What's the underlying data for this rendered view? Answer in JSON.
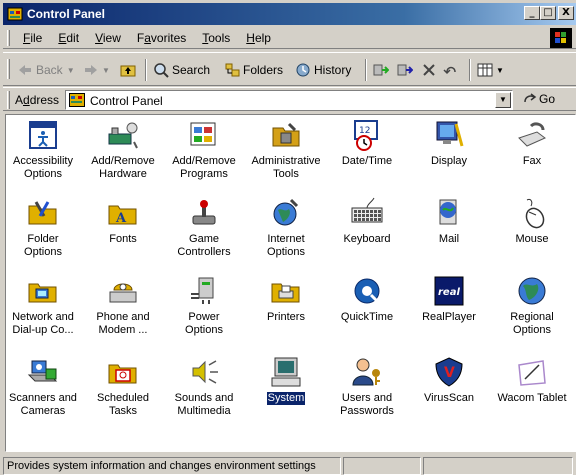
{
  "window": {
    "title": "Control Panel",
    "controls": {
      "minimize": "_",
      "maximize": "□",
      "close": "X"
    }
  },
  "menubar": {
    "items": [
      {
        "accel": "F",
        "rest": "ile"
      },
      {
        "accel": "E",
        "rest": "dit"
      },
      {
        "accel": "V",
        "rest": "iew"
      },
      {
        "pre": "F",
        "accel": "a",
        "rest": "vorites"
      },
      {
        "accel": "T",
        "rest": "ools"
      },
      {
        "accel": "H",
        "rest": "elp"
      }
    ]
  },
  "toolbar": {
    "back": "Back",
    "search": "Search",
    "folders": "Folders",
    "history": "History"
  },
  "addressbar": {
    "label_accel": "d",
    "label_pre": "A",
    "label_rest": "dress",
    "value": "Control Panel",
    "go": "Go"
  },
  "items": [
    {
      "label1": "Accessibility",
      "label2": "Options",
      "icon": "accessibility-icon",
      "color": "#1a5fb4"
    },
    {
      "label1": "Add/Remove",
      "label2": "Hardware",
      "icon": "add-remove-hardware-icon",
      "color": "#2e8b57"
    },
    {
      "label1": "Add/Remove",
      "label2": "Programs",
      "icon": "add-remove-programs-icon",
      "color": "#3a7bd5"
    },
    {
      "label1": "Administrative",
      "label2": "Tools",
      "icon": "administrative-tools-icon",
      "color": "#d4a017"
    },
    {
      "label1": "Date/Time",
      "label2": "",
      "icon": "date-time-icon",
      "color": "#1a3d8f"
    },
    {
      "label1": "Display",
      "label2": "",
      "icon": "display-icon",
      "color": "#3355aa"
    },
    {
      "label1": "Fax",
      "label2": "",
      "icon": "fax-icon",
      "color": "#999999"
    },
    {
      "label1": "Folder Options",
      "label2": "",
      "icon": "folder-options-icon",
      "color": "#e0b000"
    },
    {
      "label1": "Fonts",
      "label2": "",
      "icon": "fonts-icon",
      "color": "#e0b000"
    },
    {
      "label1": "Game",
      "label2": "Controllers",
      "icon": "game-controllers-icon",
      "color": "#888888"
    },
    {
      "label1": "Internet",
      "label2": "Options",
      "icon": "internet-options-icon",
      "color": "#2e8b57"
    },
    {
      "label1": "Keyboard",
      "label2": "",
      "icon": "keyboard-icon",
      "color": "#555555"
    },
    {
      "label1": "Mail",
      "label2": "",
      "icon": "mail-icon",
      "color": "#3366cc"
    },
    {
      "label1": "Mouse",
      "label2": "",
      "icon": "mouse-icon",
      "color": "#cccccc"
    },
    {
      "label1": "Network and",
      "label2": "Dial-up Co...",
      "icon": "network-icon",
      "color": "#3a7bd5"
    },
    {
      "label1": "Phone and",
      "label2": "Modem ...",
      "icon": "phone-modem-icon",
      "color": "#e0b000"
    },
    {
      "label1": "Power Options",
      "label2": "",
      "icon": "power-options-icon",
      "color": "#888888"
    },
    {
      "label1": "Printers",
      "label2": "",
      "icon": "printers-icon",
      "color": "#e0b000"
    },
    {
      "label1": "QuickTime",
      "label2": "",
      "icon": "quicktime-icon",
      "color": "#1a5fb4"
    },
    {
      "label1": "RealPlayer",
      "label2": "",
      "icon": "realplayer-icon",
      "color": "#0a1a6a"
    },
    {
      "label1": "Regional",
      "label2": "Options",
      "icon": "regional-options-icon",
      "color": "#2e8b57"
    },
    {
      "label1": "Scanners and",
      "label2": "Cameras",
      "icon": "scanners-icon",
      "color": "#3a7bd5"
    },
    {
      "label1": "Scheduled",
      "label2": "Tasks",
      "icon": "scheduled-tasks-icon",
      "color": "#e0b000"
    },
    {
      "label1": "Sounds and",
      "label2": "Multimedia",
      "icon": "sounds-icon",
      "color": "#d4c000"
    },
    {
      "label1": "System",
      "label2": "",
      "icon": "system-icon",
      "color": "#2a6e6e",
      "selected": true
    },
    {
      "label1": "Users and",
      "label2": "Passwords",
      "icon": "users-icon",
      "color": "#b8860b"
    },
    {
      "label1": "VirusScan",
      "label2": "",
      "icon": "virusscan-icon",
      "color": "#1a3d8f"
    },
    {
      "label1": "Wacom Tablet",
      "label2": "",
      "icon": "wacom-icon",
      "color": "#aa88cc"
    }
  ],
  "status": {
    "text": "Provides system information and changes environment settings"
  }
}
